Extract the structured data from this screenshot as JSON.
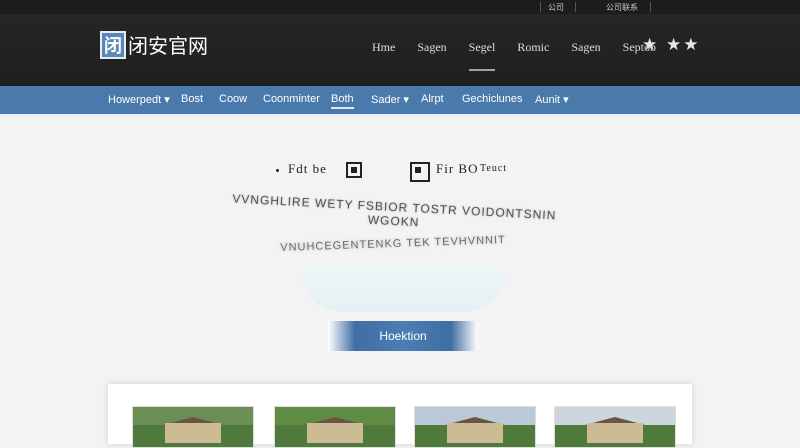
{
  "top_strip": {
    "link1": "公司",
    "link2": "公司联系"
  },
  "header": {
    "logo_mark": "闭",
    "logo_text": "闭安官网",
    "nav": [
      "Hme",
      "Sagen",
      "Segel",
      "Romic",
      "Sagen",
      "Septob"
    ],
    "stars": "★ ★★"
  },
  "blue_nav": [
    "Howerpedt ▾",
    "Bost",
    "Coow",
    "Coonminter",
    "Both",
    "Sader ▾",
    "Alrpt",
    "Gechiclunes",
    "Aunit ▾"
  ],
  "hero": {
    "badge_text1": "Fdt be",
    "badge_text2": "Fir BO",
    "badge_text3": "Teuct",
    "headline1": "VVNGHLIRE WETY FSBIOR TOSTR VOIDONTSNIN WGOKN",
    "headline2": "VNUHCEGENTENKG TEK TEVHVNNIT",
    "cta": "Hoektion"
  }
}
